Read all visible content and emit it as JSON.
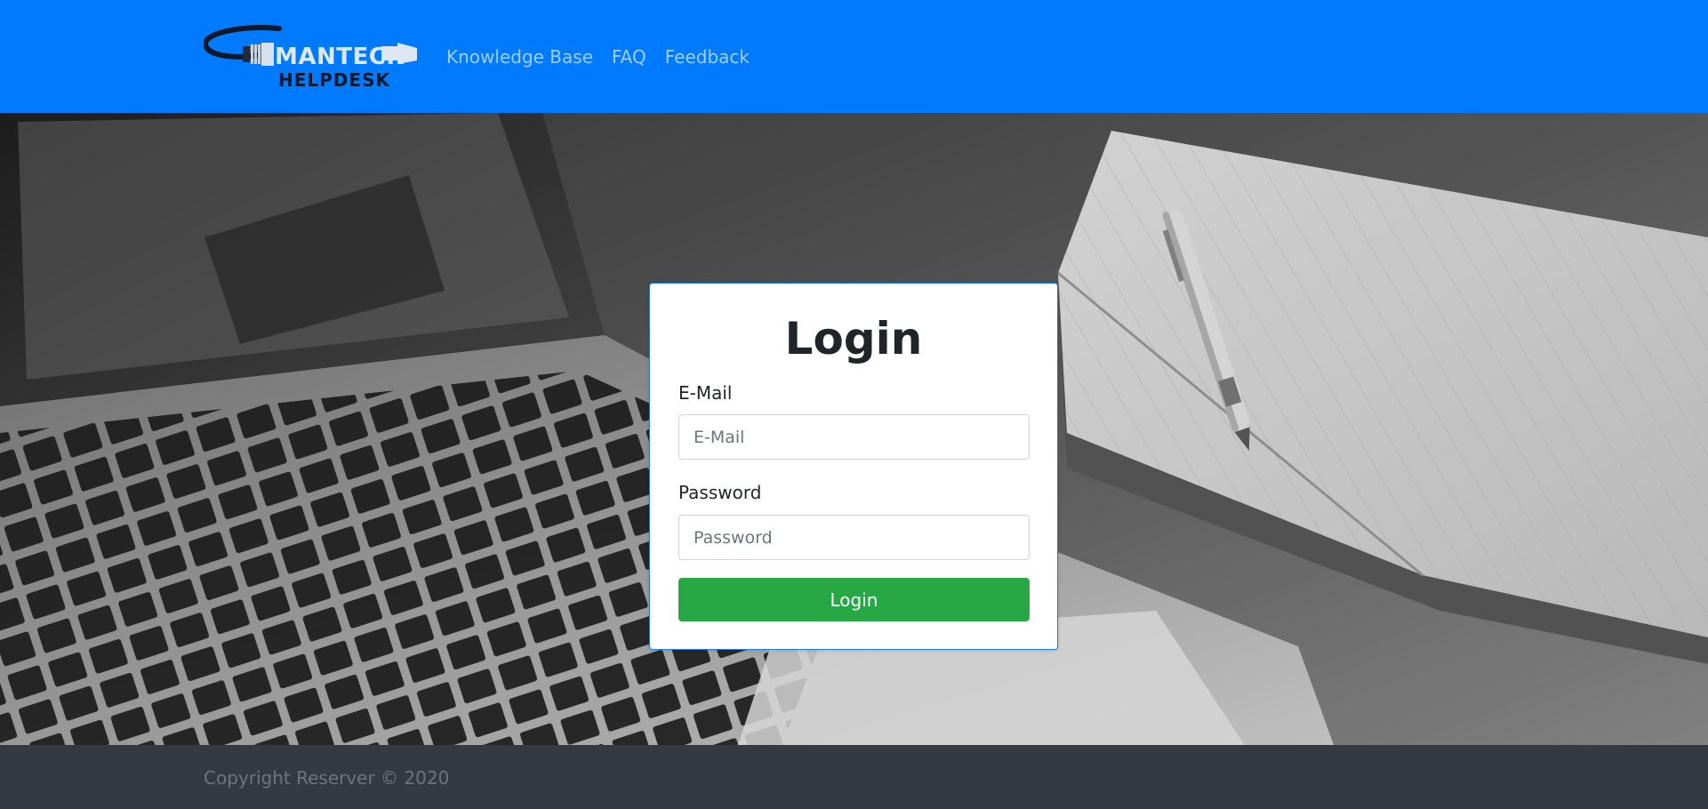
{
  "header": {
    "logo_text": "MANTECH HELPDESK",
    "nav": [
      {
        "label": "Knowledge Base"
      },
      {
        "label": "FAQ"
      },
      {
        "label": "Feedback"
      }
    ]
  },
  "login": {
    "title": "Login",
    "email_label": "E-Mail",
    "email_placeholder": "E-Mail",
    "email_value": "",
    "password_label": "Password",
    "password_placeholder": "Password",
    "password_value": "",
    "submit_label": "Login"
  },
  "footer": {
    "copyright": "Copyright Reserver © 2020"
  },
  "colors": {
    "navbar": "#007bff",
    "login_button": "#28a745",
    "footer": "#343a40"
  },
  "icons": {
    "logo": "cable-plug-logo",
    "hero_background": "laptop-notebook-pen-photo"
  }
}
